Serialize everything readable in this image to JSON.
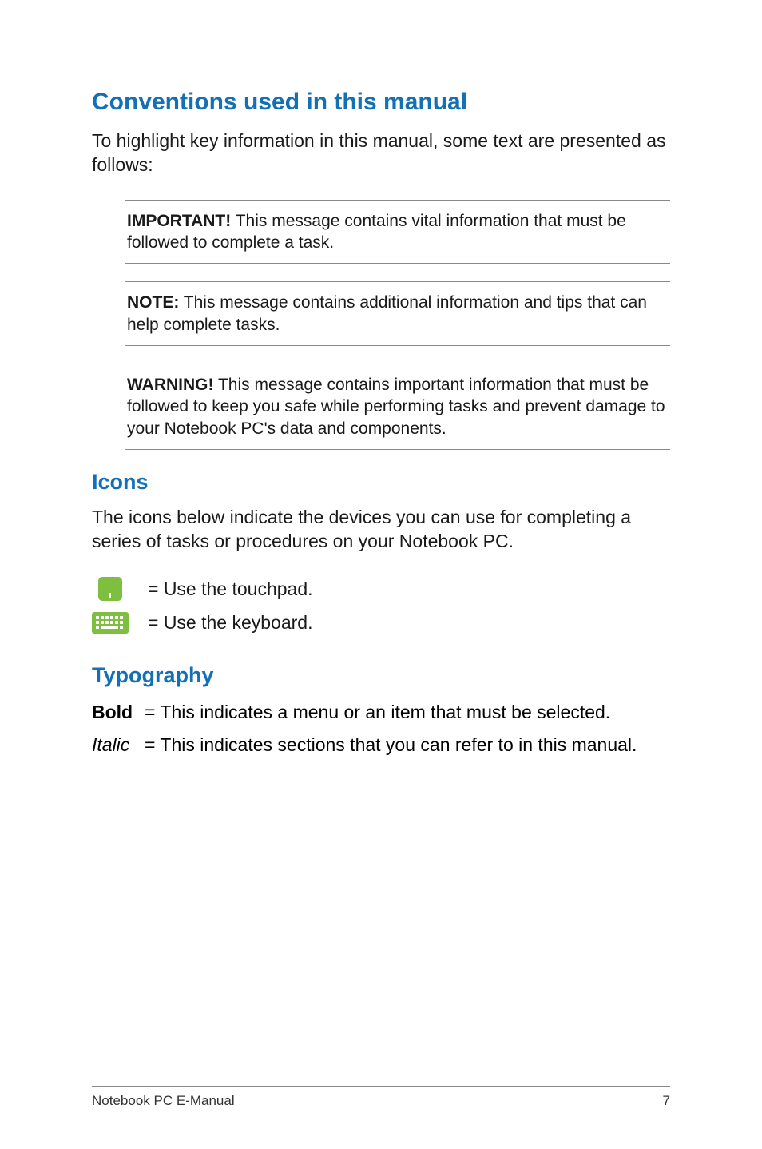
{
  "headings": {
    "conventions": "Conventions used in this manual",
    "icons": "Icons",
    "typography": "Typography"
  },
  "conventions": {
    "intro": "To highlight key information in this manual, some text are presented as follows:",
    "important": {
      "label": "IMPORTANT!",
      "text": " This message contains vital information that must be followed to complete a task."
    },
    "note": {
      "label": "NOTE:",
      "text": " This message contains additional information and tips that can help complete tasks."
    },
    "warning": {
      "label": "WARNING!",
      "text": " This message contains important information that must be followed to keep you safe while performing tasks and prevent damage to your Notebook PC's data and components."
    }
  },
  "icons": {
    "intro": "The icons below indicate the devices you can use for completing a series of tasks or procedures on your Notebook PC.",
    "touchpad": "= Use the touchpad.",
    "keyboard": "= Use the keyboard."
  },
  "typography": {
    "bold_key": "Bold",
    "bold_desc": "= This indicates a menu or an item that must be selected.",
    "italic_key": "Italic",
    "italic_desc": "= This indicates sections that you can refer to in this manual."
  },
  "footer": {
    "title": "Notebook PC E-Manual",
    "page_number": "7"
  }
}
